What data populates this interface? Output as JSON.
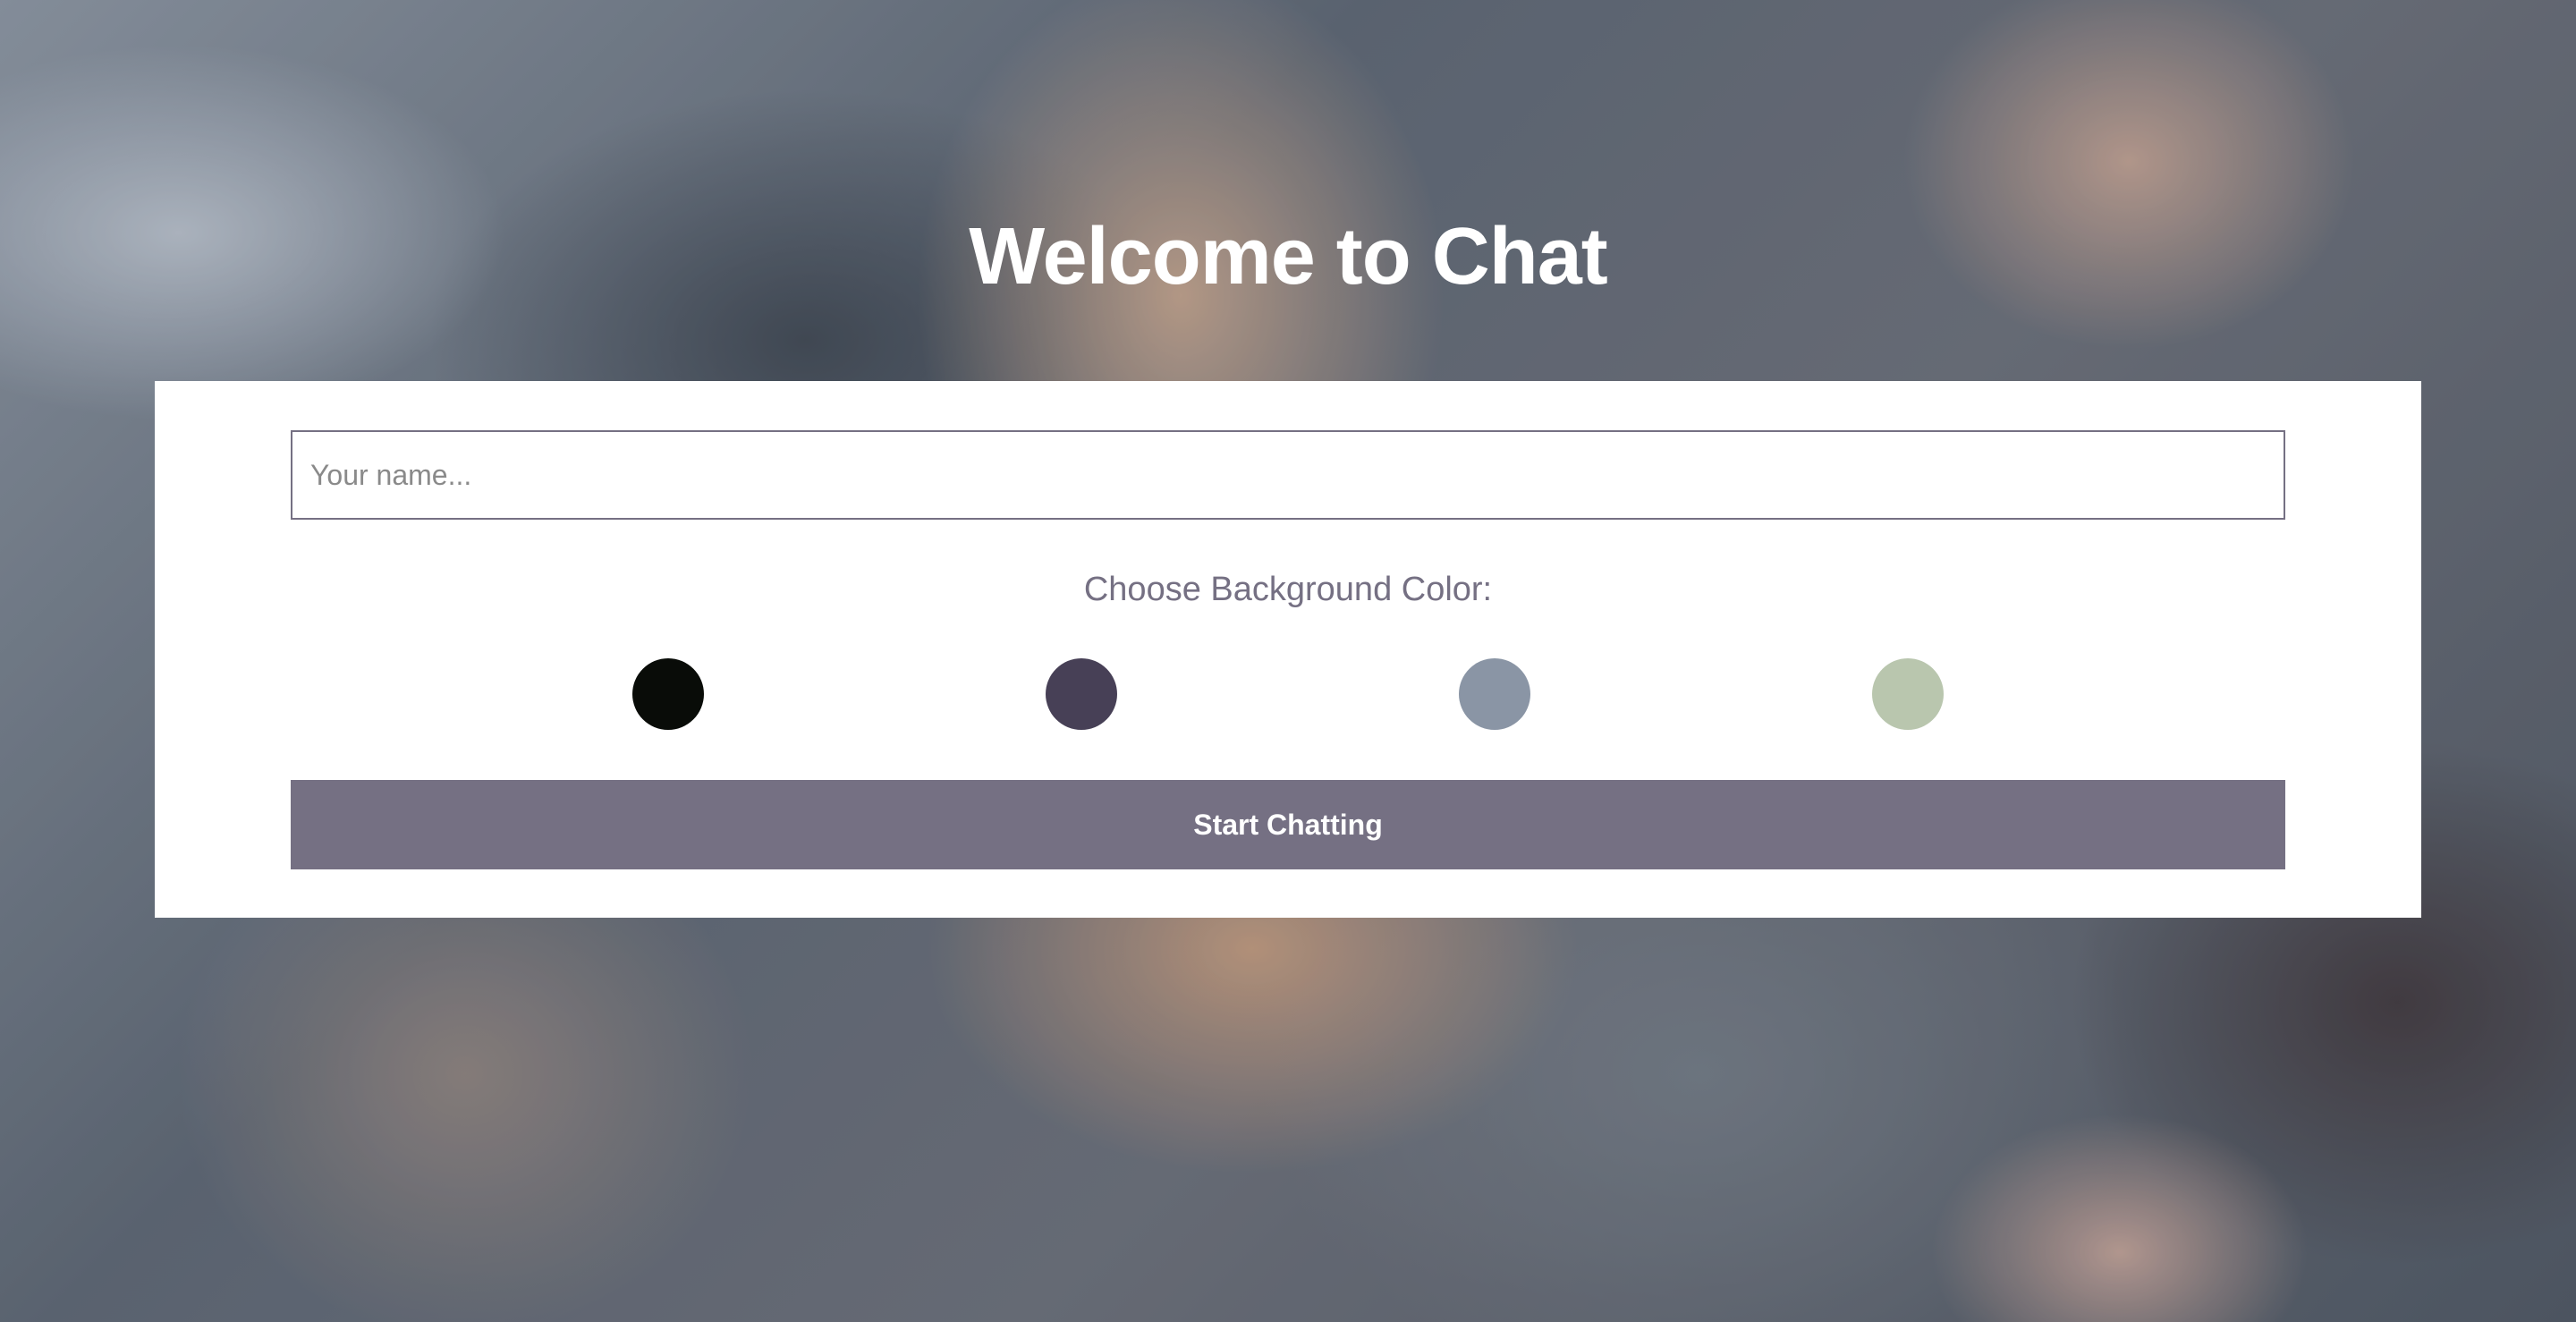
{
  "app": {
    "title": "Welcome to Chat"
  },
  "form": {
    "name_value": "",
    "name_placeholder": "Your name...",
    "color_prompt": "Choose Background Color:",
    "colors": [
      "#090C08",
      "#474056",
      "#8A95A5",
      "#B9C6AE"
    ],
    "start_label": "Start Chatting",
    "start_color": "#757083"
  }
}
